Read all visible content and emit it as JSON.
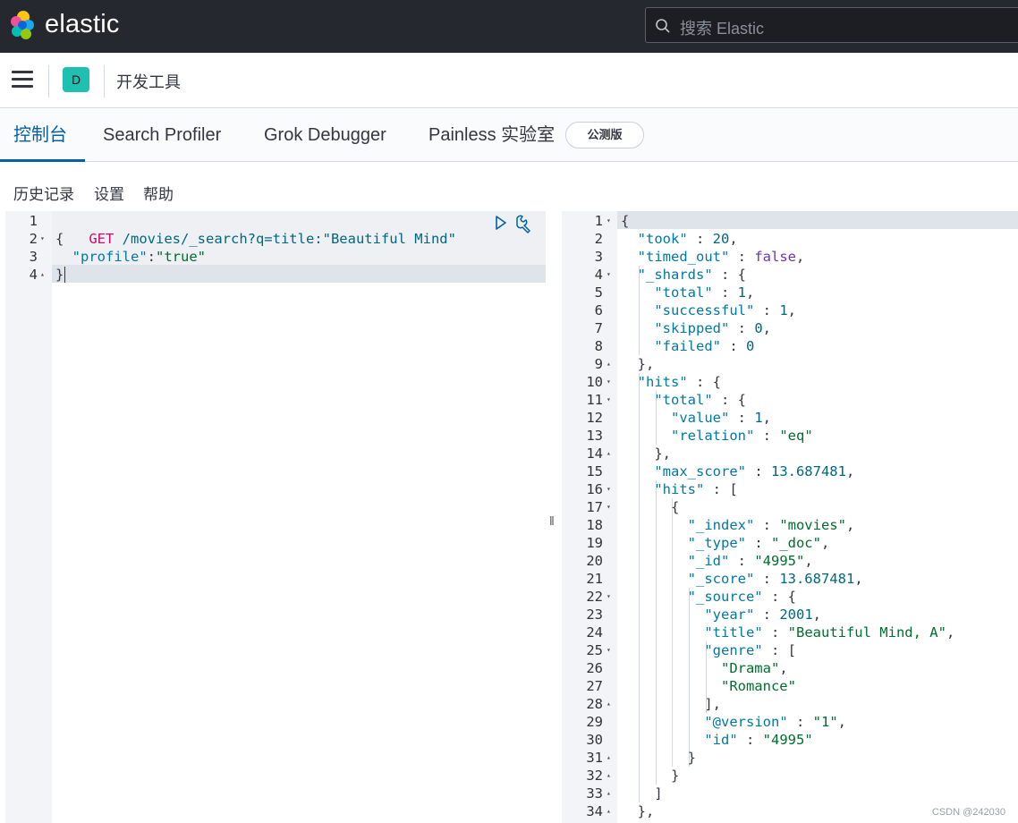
{
  "header": {
    "logo_text": "elastic",
    "search_placeholder": "搜索 Elastic"
  },
  "breadcrumb": {
    "space_initial": "D",
    "title": "开发工具"
  },
  "tabs": [
    {
      "label": "控制台",
      "active": true
    },
    {
      "label": "Search Profiler",
      "active": false
    },
    {
      "label": "Grok Debugger",
      "active": false
    },
    {
      "label": "Painless 实验室",
      "active": false
    }
  ],
  "beta_badge": "公测版",
  "submenu": [
    "历史记录",
    "设置",
    "帮助"
  ],
  "request": {
    "method": "GET",
    "url": "/movies/_search?q=title:\"Beautiful Mind\"",
    "lines": [
      {
        "n": "1",
        "fold": "",
        "text": ""
      },
      {
        "n": "2",
        "fold": "▾",
        "text": "{"
      },
      {
        "n": "3",
        "fold": "",
        "text": ""
      },
      {
        "n": "4",
        "fold": "▴",
        "text": "}"
      }
    ],
    "body_key": "\"profile\"",
    "body_colon": ":",
    "body_value": "\"true\""
  },
  "response": {
    "lines": [
      {
        "n": "1",
        "fold": "▾",
        "html": [
          [
            "p",
            "{"
          ]
        ]
      },
      {
        "n": "2",
        "fold": "",
        "html": [
          [
            "s",
            "  "
          ],
          [
            "k",
            "\"took\""
          ],
          [
            "p",
            " : "
          ],
          [
            "n",
            "20"
          ],
          [
            "p",
            ","
          ]
        ]
      },
      {
        "n": "3",
        "fold": "",
        "html": [
          [
            "s",
            "  "
          ],
          [
            "k",
            "\"timed_out\""
          ],
          [
            "p",
            " : "
          ],
          [
            "b",
            "false"
          ],
          [
            "p",
            ","
          ]
        ]
      },
      {
        "n": "4",
        "fold": "▾",
        "html": [
          [
            "s",
            "  "
          ],
          [
            "k",
            "\"_shards\""
          ],
          [
            "p",
            " : {"
          ]
        ]
      },
      {
        "n": "5",
        "fold": "",
        "html": [
          [
            "s",
            "    "
          ],
          [
            "k",
            "\"total\""
          ],
          [
            "p",
            " : "
          ],
          [
            "n",
            "1"
          ],
          [
            "p",
            ","
          ]
        ]
      },
      {
        "n": "6",
        "fold": "",
        "html": [
          [
            "s",
            "    "
          ],
          [
            "k",
            "\"successful\""
          ],
          [
            "p",
            " : "
          ],
          [
            "n",
            "1"
          ],
          [
            "p",
            ","
          ]
        ]
      },
      {
        "n": "7",
        "fold": "",
        "html": [
          [
            "s",
            "    "
          ],
          [
            "k",
            "\"skipped\""
          ],
          [
            "p",
            " : "
          ],
          [
            "n",
            "0"
          ],
          [
            "p",
            ","
          ]
        ]
      },
      {
        "n": "8",
        "fold": "",
        "html": [
          [
            "s",
            "    "
          ],
          [
            "k",
            "\"failed\""
          ],
          [
            "p",
            " : "
          ],
          [
            "n",
            "0"
          ]
        ]
      },
      {
        "n": "9",
        "fold": "▴",
        "html": [
          [
            "s",
            "  "
          ],
          [
            "p",
            "},"
          ]
        ]
      },
      {
        "n": "10",
        "fold": "▾",
        "html": [
          [
            "s",
            "  "
          ],
          [
            "k",
            "\"hits\""
          ],
          [
            "p",
            " : {"
          ]
        ]
      },
      {
        "n": "11",
        "fold": "▾",
        "html": [
          [
            "s",
            "    "
          ],
          [
            "k",
            "\"total\""
          ],
          [
            "p",
            " : {"
          ]
        ]
      },
      {
        "n": "12",
        "fold": "",
        "html": [
          [
            "s",
            "      "
          ],
          [
            "k",
            "\"value\""
          ],
          [
            "p",
            " : "
          ],
          [
            "n",
            "1"
          ],
          [
            "p",
            ","
          ]
        ]
      },
      {
        "n": "13",
        "fold": "",
        "html": [
          [
            "s",
            "      "
          ],
          [
            "k",
            "\"relation\""
          ],
          [
            "p",
            " : "
          ],
          [
            "t",
            "\"eq\""
          ]
        ]
      },
      {
        "n": "14",
        "fold": "▴",
        "html": [
          [
            "s",
            "    "
          ],
          [
            "p",
            "},"
          ]
        ]
      },
      {
        "n": "15",
        "fold": "",
        "html": [
          [
            "s",
            "    "
          ],
          [
            "k",
            "\"max_score\""
          ],
          [
            "p",
            " : "
          ],
          [
            "n",
            "13.687481"
          ],
          [
            "p",
            ","
          ]
        ]
      },
      {
        "n": "16",
        "fold": "▾",
        "html": [
          [
            "s",
            "    "
          ],
          [
            "k",
            "\"hits\""
          ],
          [
            "p",
            " : ["
          ]
        ]
      },
      {
        "n": "17",
        "fold": "▾",
        "html": [
          [
            "s",
            "      "
          ],
          [
            "p",
            "{"
          ]
        ]
      },
      {
        "n": "18",
        "fold": "",
        "html": [
          [
            "s",
            "        "
          ],
          [
            "k",
            "\"_index\""
          ],
          [
            "p",
            " : "
          ],
          [
            "t",
            "\"movies\""
          ],
          [
            "p",
            ","
          ]
        ]
      },
      {
        "n": "19",
        "fold": "",
        "html": [
          [
            "s",
            "        "
          ],
          [
            "k",
            "\"_type\""
          ],
          [
            "p",
            " : "
          ],
          [
            "t",
            "\"_doc\""
          ],
          [
            "p",
            ","
          ]
        ]
      },
      {
        "n": "20",
        "fold": "",
        "html": [
          [
            "s",
            "        "
          ],
          [
            "k",
            "\"_id\""
          ],
          [
            "p",
            " : "
          ],
          [
            "t",
            "\"4995\""
          ],
          [
            "p",
            ","
          ]
        ]
      },
      {
        "n": "21",
        "fold": "",
        "html": [
          [
            "s",
            "        "
          ],
          [
            "k",
            "\"_score\""
          ],
          [
            "p",
            " : "
          ],
          [
            "n",
            "13.687481"
          ],
          [
            "p",
            ","
          ]
        ]
      },
      {
        "n": "22",
        "fold": "▾",
        "html": [
          [
            "s",
            "        "
          ],
          [
            "k",
            "\"_source\""
          ],
          [
            "p",
            " : {"
          ]
        ]
      },
      {
        "n": "23",
        "fold": "",
        "html": [
          [
            "s",
            "          "
          ],
          [
            "k",
            "\"year\""
          ],
          [
            "p",
            " : "
          ],
          [
            "n",
            "2001"
          ],
          [
            "p",
            ","
          ]
        ]
      },
      {
        "n": "24",
        "fold": "",
        "html": [
          [
            "s",
            "          "
          ],
          [
            "k",
            "\"title\""
          ],
          [
            "p",
            " : "
          ],
          [
            "t",
            "\"Beautiful Mind, A\""
          ],
          [
            "p",
            ","
          ]
        ]
      },
      {
        "n": "25",
        "fold": "▾",
        "html": [
          [
            "s",
            "          "
          ],
          [
            "k",
            "\"genre\""
          ],
          [
            "p",
            " : ["
          ]
        ]
      },
      {
        "n": "26",
        "fold": "",
        "html": [
          [
            "s",
            "            "
          ],
          [
            "t",
            "\"Drama\""
          ],
          [
            "p",
            ","
          ]
        ]
      },
      {
        "n": "27",
        "fold": "",
        "html": [
          [
            "s",
            "            "
          ],
          [
            "t",
            "\"Romance\""
          ]
        ]
      },
      {
        "n": "28",
        "fold": "▴",
        "html": [
          [
            "s",
            "          "
          ],
          [
            "p",
            "],"
          ]
        ]
      },
      {
        "n": "29",
        "fold": "",
        "html": [
          [
            "s",
            "          "
          ],
          [
            "k",
            "\"@version\""
          ],
          [
            "p",
            " : "
          ],
          [
            "t",
            "\"1\""
          ],
          [
            "p",
            ","
          ]
        ]
      },
      {
        "n": "30",
        "fold": "",
        "html": [
          [
            "s",
            "          "
          ],
          [
            "k",
            "\"id\""
          ],
          [
            "p",
            " : "
          ],
          [
            "t",
            "\"4995\""
          ]
        ]
      },
      {
        "n": "31",
        "fold": "▴",
        "html": [
          [
            "s",
            "        "
          ],
          [
            "p",
            "}"
          ]
        ]
      },
      {
        "n": "32",
        "fold": "▴",
        "html": [
          [
            "s",
            "      "
          ],
          [
            "p",
            "}"
          ]
        ]
      },
      {
        "n": "33",
        "fold": "▴",
        "html": [
          [
            "s",
            "    "
          ],
          [
            "p",
            "]"
          ]
        ]
      },
      {
        "n": "34",
        "fold": "▴",
        "html": [
          [
            "s",
            "  "
          ],
          [
            "p",
            "},"
          ]
        ]
      }
    ]
  },
  "watermark": "CSDN @242030"
}
